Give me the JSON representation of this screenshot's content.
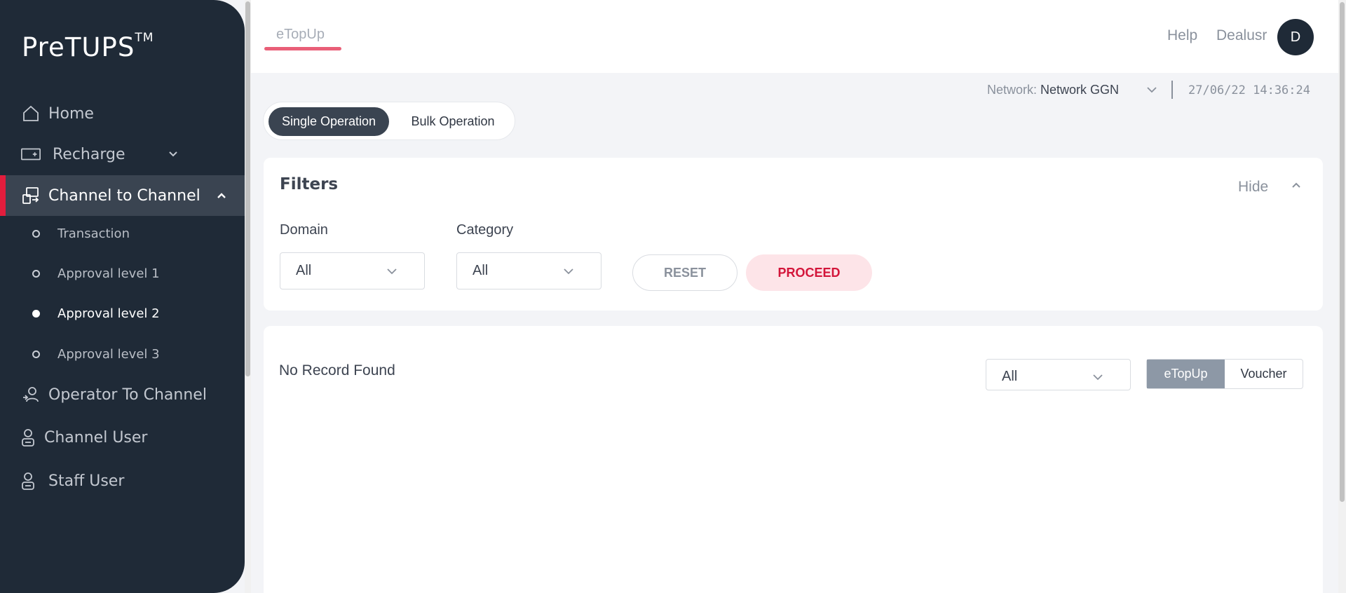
{
  "sidebar": {
    "logo": "PreTUPS",
    "logo_tm": "TM",
    "items": [
      {
        "label": "Home",
        "icon": "home-icon"
      },
      {
        "label": "Recharge",
        "icon": "recharge-icon"
      },
      {
        "label": "Channel to Channel",
        "icon": "channel-to-channel-icon"
      },
      {
        "label": "Operator To Channel",
        "icon": "operator-to-channel-icon"
      },
      {
        "label": "Channel User",
        "icon": "user-icon"
      },
      {
        "label": "Staff User",
        "icon": "staff-user-icon"
      }
    ],
    "subitems": [
      {
        "label": "Transaction"
      },
      {
        "label": "Approval level 1"
      },
      {
        "label": "Approval level 2"
      },
      {
        "label": "Approval level 3"
      }
    ],
    "active_item": "Channel to Channel",
    "selected_subitem": "Approval level 2"
  },
  "header": {
    "tab": "eTopUp",
    "help": "Help",
    "username": "Dealusr",
    "avatar_letter": "D",
    "network_label": "Network:",
    "network_value": "Network GGN",
    "datetime": "27/06/22 14:36:24"
  },
  "operation_toggle": {
    "single": "Single Operation",
    "bulk": "Bulk Operation",
    "selected": "Single Operation"
  },
  "filters": {
    "title": "Filters",
    "hide": "Hide",
    "domain_label": "Domain",
    "domain_value": "All",
    "category_label": "Category",
    "category_value": "All",
    "reset": "RESET",
    "proceed": "PROCEED"
  },
  "results": {
    "message": "No Record Found",
    "select_value": "All",
    "segments": [
      "eTopUp",
      "Voucher"
    ],
    "selected_segment": "eTopUp"
  },
  "colors": {
    "sidebar_bg": "#1f2a37",
    "accent": "#e21d3d",
    "proceed_bg": "#fde4e8"
  }
}
